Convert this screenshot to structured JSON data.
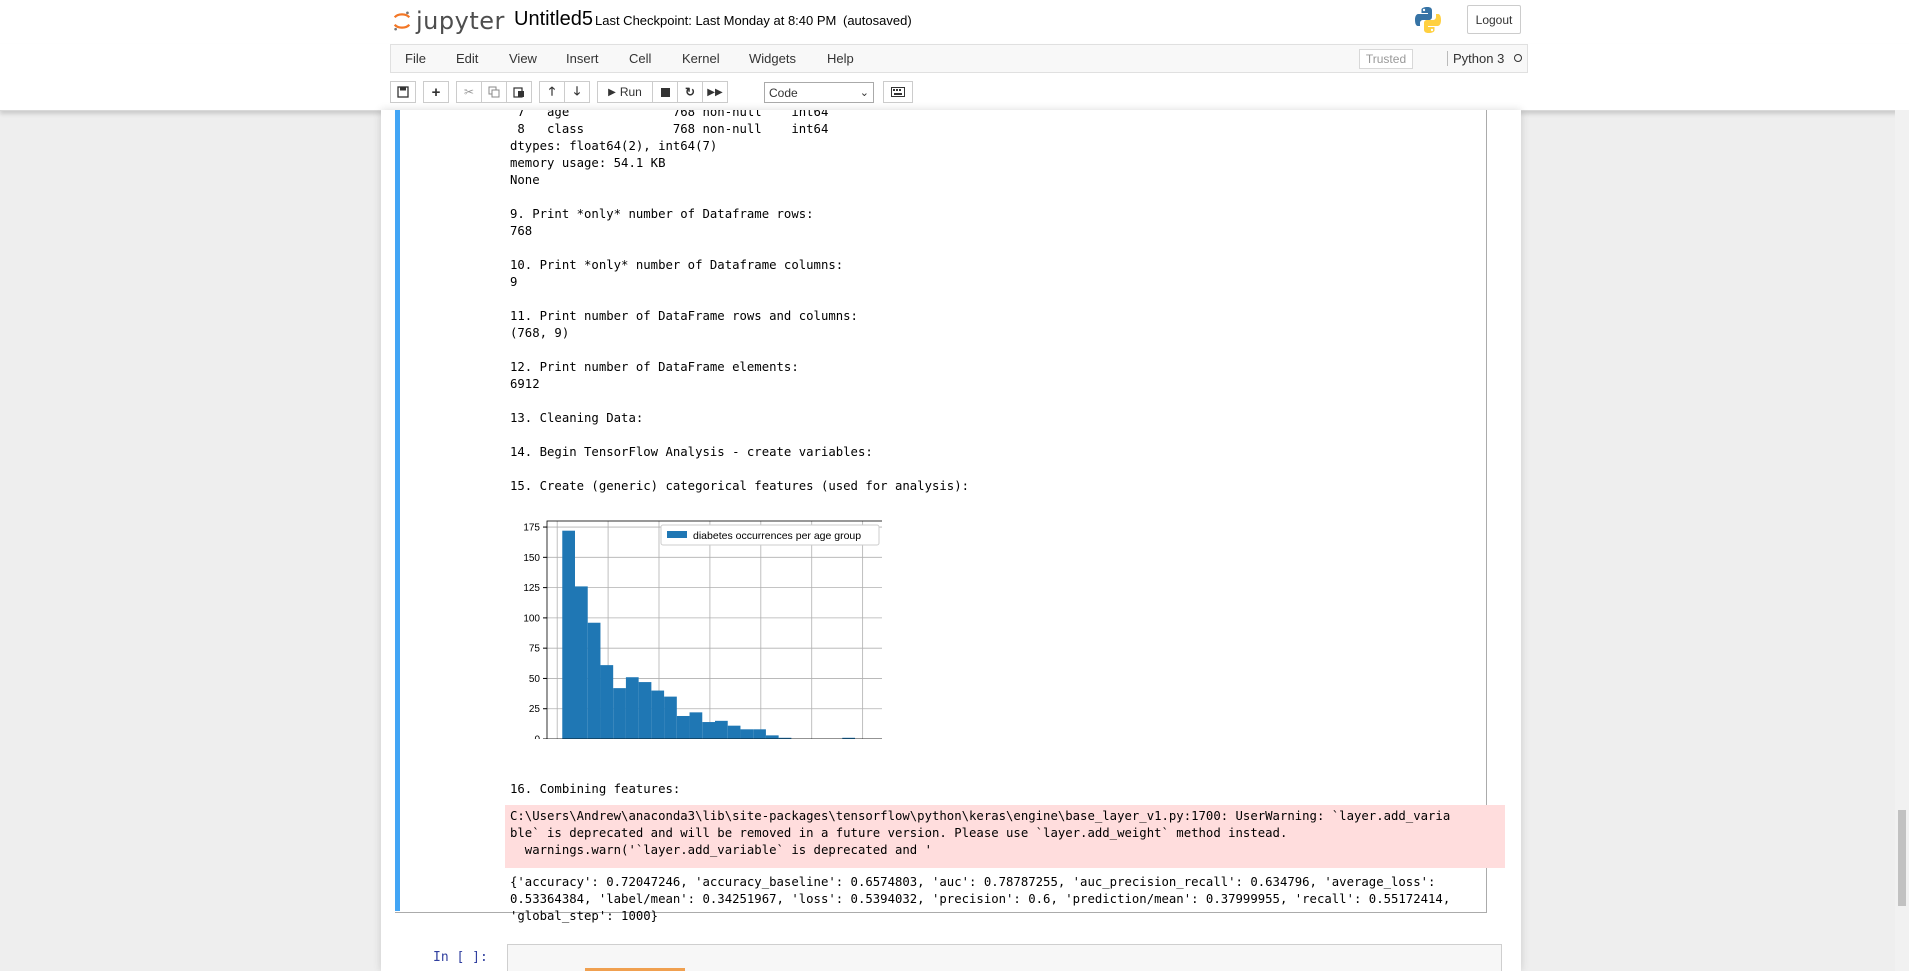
{
  "header": {
    "logo_text": "jupyter",
    "notebook_name": "Untitled5",
    "checkpoint": "Last Checkpoint: Last Monday at 8:40 PM",
    "autosave_status": "(autosaved)",
    "logout_label": "Logout"
  },
  "menu": {
    "items": [
      "File",
      "Edit",
      "View",
      "Insert",
      "Cell",
      "Kernel",
      "Widgets",
      "Help"
    ],
    "trusted_label": "Trusted",
    "kernel_name": "Python 3"
  },
  "toolbar": {
    "run_label": "Run",
    "cell_type": "Code"
  },
  "output_lines": [
    " 7   age              768 non-null    int64",
    " 8   class            768 non-null    int64",
    "dtypes: float64(2), int64(7)",
    "memory usage: 54.1 KB",
    "None",
    "",
    "9. Print *only* number of Dataframe rows:",
    "768",
    "",
    "10. Print *only* number of Dataframe columns:",
    "9",
    "",
    "11. Print number of DataFrame rows and columns:",
    "(768, 9)",
    "",
    "12. Print number of DataFrame elements:",
    "6912",
    "",
    "13. Cleaning Data:",
    "",
    "14. Begin TensorFlow Analysis - create variables:",
    "",
    "15. Create (generic) categorical features (used for analysis):"
  ],
  "section16_label": "16. Combining features:",
  "stderr_lines": [
    "C:\\Users\\Andrew\\anaconda3\\lib\\site-packages\\tensorflow\\python\\keras\\engine\\base_layer_v1.py:1700: UserWarning: `layer.add_varia",
    "ble` is deprecated and will be removed in a future version. Please use `layer.add_weight` method instead.",
    "  warnings.warn('`layer.add_variable` is deprecated and '"
  ],
  "result_lines": [
    "{'accuracy': 0.72047246, 'accuracy_baseline': 0.6574803, 'auc': 0.78787255, 'auc_precision_recall': 0.634796, 'average_loss':",
    "0.53364384, 'label/mean': 0.34251967, 'loss': 0.5394032, 'precision': 0.6, 'prediction/mean': 0.37999955, 'recall': 0.55172414,",
    "'global_step': 1000}"
  ],
  "next_cell_prompt": "In [ ]:",
  "chart_data": {
    "type": "bar",
    "legend": "diabetes occurrences per age group",
    "legend_position": "top-right",
    "bar_color": "#1f77b4",
    "grid": true,
    "bin_edges": [
      21,
      23.5,
      26,
      28.5,
      31,
      33.5,
      36,
      38.5,
      41,
      43.5,
      46,
      48.5,
      51,
      53.5,
      56,
      58.5,
      61,
      63.5,
      66,
      68.5,
      71,
      73.5,
      76,
      78.5,
      81
    ],
    "values": [
      172,
      126,
      96,
      61,
      42,
      51,
      47,
      40,
      35,
      19,
      22,
      14,
      15,
      11,
      8,
      8,
      3,
      1,
      0,
      0,
      0,
      0,
      1,
      0
    ],
    "xlim": [
      18,
      84
    ],
    "ylim": [
      0,
      180
    ],
    "xticks": [
      20,
      30,
      40,
      50,
      60,
      70,
      80
    ],
    "yticks": [
      0,
      25,
      50,
      75,
      100,
      125,
      150,
      175
    ]
  }
}
